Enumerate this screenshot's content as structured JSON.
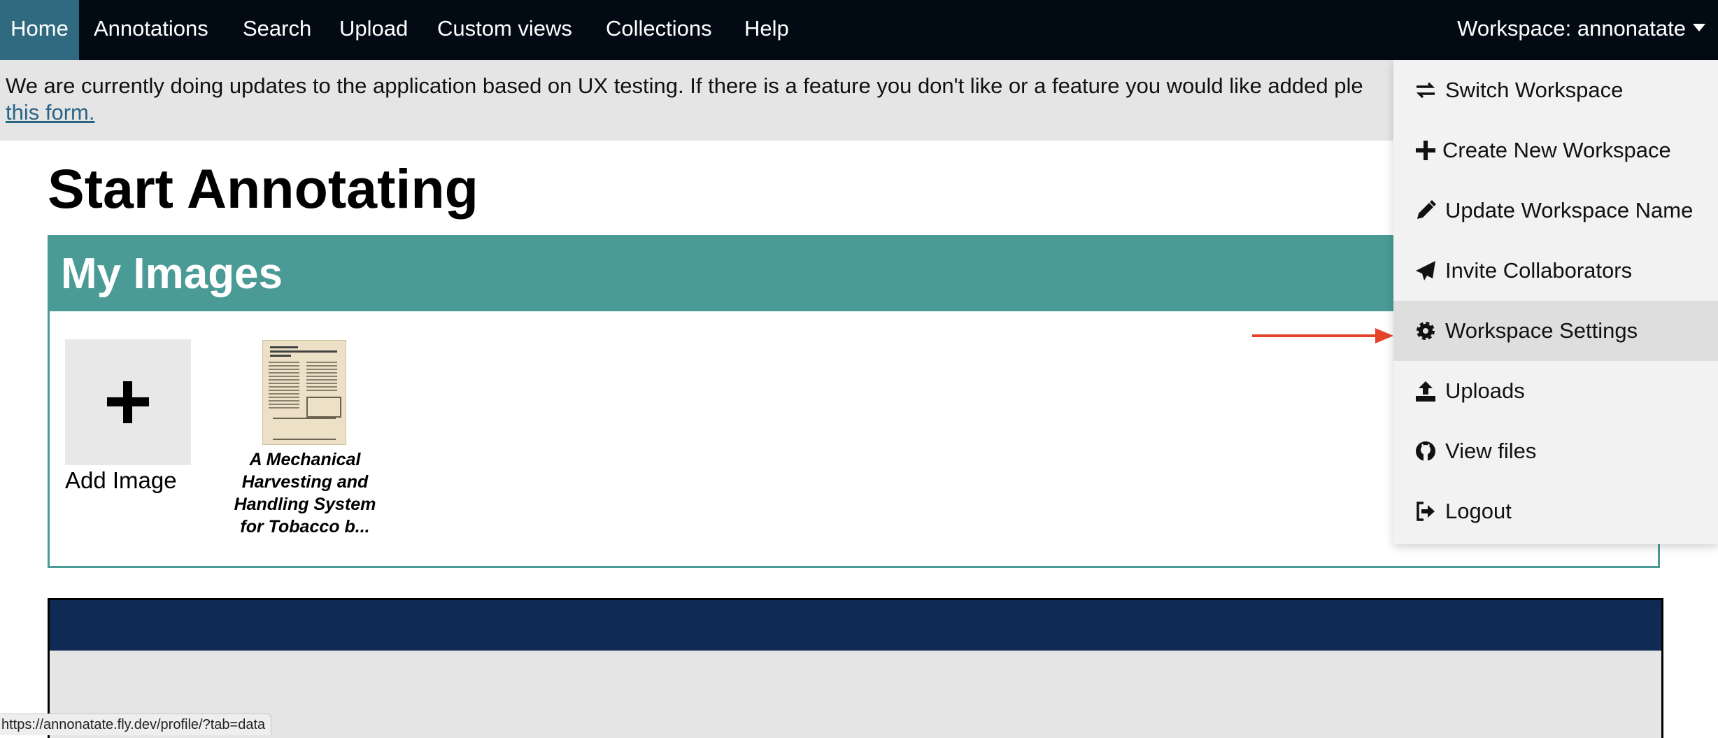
{
  "nav": {
    "items": [
      "Home",
      "Annotations",
      "Search",
      "Upload",
      "Custom views",
      "Collections",
      "Help"
    ],
    "workspace_label": "Workspace: annonatate"
  },
  "notice": {
    "text": "We are currently doing updates to the application based on UX testing. If there is a feature you don't like or a feature you would like added ple",
    "link": "this form."
  },
  "page_title": "Start Annotating",
  "my_images": {
    "title": "My Images",
    "add_label": "Add Image",
    "items": [
      {
        "caption": "A Mechanical Harvesting and Handling System for Tobacco b..."
      }
    ]
  },
  "workspace_menu": {
    "items": [
      {
        "label": "Switch Workspace",
        "icon": "exchange-icon"
      },
      {
        "label": "Create New Workspace",
        "icon": "plus-icon"
      },
      {
        "label": "Update Workspace Name",
        "icon": "pencil-icon"
      },
      {
        "label": "Invite Collaborators",
        "icon": "paper-plane-icon"
      },
      {
        "label": "Workspace Settings",
        "icon": "gear-icon"
      },
      {
        "label": "Uploads",
        "icon": "upload-icon"
      },
      {
        "label": "View files",
        "icon": "github-icon"
      },
      {
        "label": "Logout",
        "icon": "sign-out-icon"
      }
    ],
    "highlighted": "Workspace Settings"
  },
  "colors": {
    "nav_bg": "#020b14",
    "nav_active": "#2f6a80",
    "card_accent": "#4a9a96",
    "dark_card_header": "#0f2a55",
    "annotation_arrow": "#e5442b"
  },
  "status_bar": "https://annonatate.fly.dev/profile/?tab=data"
}
